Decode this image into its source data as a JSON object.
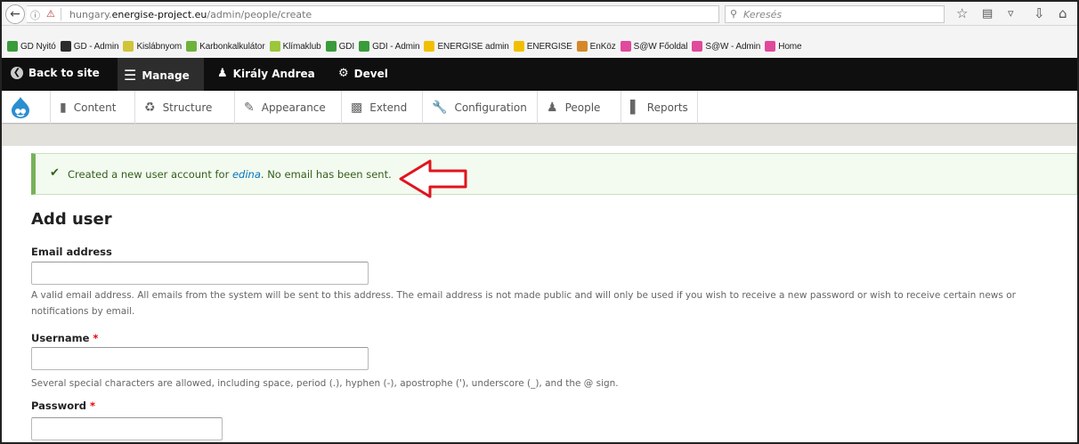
{
  "browser": {
    "url_prefix": "hungary.",
    "url_domain": "energise-project.eu",
    "url_path": "/admin/people/create",
    "search_placeholder": "Keresés"
  },
  "bookmarks": [
    {
      "label": "GD Nyitó",
      "color": "#3a9b3a"
    },
    {
      "label": "GD - Admin",
      "color": "#2b2b2b"
    },
    {
      "label": "Kislábnyom",
      "color": "#cfc43a"
    },
    {
      "label": "Karbonkalkulátor",
      "color": "#6fb23b"
    },
    {
      "label": "Klímaklub",
      "color": "#9cc63b"
    },
    {
      "label": "GDI",
      "color": "#3a9b3a"
    },
    {
      "label": "GDI - Admin",
      "color": "#3a9b3a"
    },
    {
      "label": "ENERGISE admin",
      "color": "#f0c000"
    },
    {
      "label": "ENERGISE",
      "color": "#f0c000"
    },
    {
      "label": "EnKöz",
      "color": "#d4882a"
    },
    {
      "label": "S@W Főoldal",
      "color": "#e04a9a"
    },
    {
      "label": "S@W - Admin",
      "color": "#e04a9a"
    },
    {
      "label": "Home",
      "color": "#e04a9a"
    }
  ],
  "admin_bar": {
    "back_to_site": "Back to site",
    "manage": "Manage",
    "user": "Király Andrea",
    "devel": "Devel"
  },
  "tray": {
    "content": "Content",
    "structure": "Structure",
    "appearance": "Appearance",
    "extend": "Extend",
    "configuration": "Configuration",
    "people": "People",
    "reports": "Reports"
  },
  "message": {
    "prefix": "Created a new user account for ",
    "link": "edina",
    "suffix": ". No email has been sent."
  },
  "page_title": "Add user",
  "form": {
    "email_label": "Email address",
    "email_desc": "A valid email address. All emails from the system will be sent to this address. The email address is not made public and will only be used if you wish to receive a new password or wish to receive certain news or notifications by email.",
    "username_label": "Username",
    "username_desc": "Several special characters are allowed, including space, period (.), hyphen (-), apostrophe ('), underscore (_), and the @ sign.",
    "password_label": "Password",
    "required_mark": "*"
  }
}
